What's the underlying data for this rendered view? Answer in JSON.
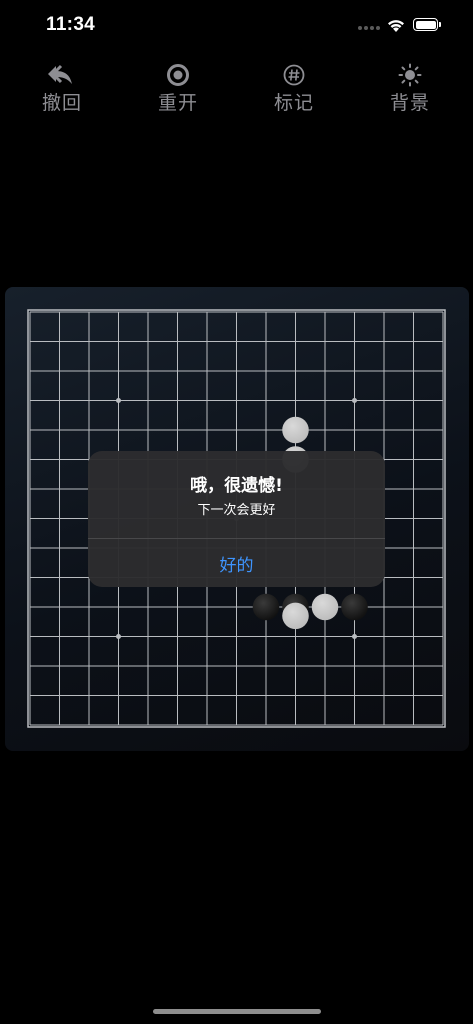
{
  "status_bar": {
    "time": "11:34"
  },
  "toolbar": {
    "items": [
      {
        "label": "撤回",
        "icon": "undo-icon"
      },
      {
        "label": "重开",
        "icon": "restart-icon"
      },
      {
        "label": "标记",
        "icon": "number-sign-icon"
      },
      {
        "label": "背景",
        "icon": "sun-icon"
      }
    ]
  },
  "board": {
    "grid_lines": 15,
    "star_points": [
      [
        3,
        3
      ],
      [
        11,
        3
      ],
      [
        3,
        11
      ],
      [
        11,
        11
      ],
      [
        7,
        7
      ]
    ],
    "stones": [
      {
        "col": 9,
        "row": 4,
        "color": "white"
      },
      {
        "col": 9,
        "row": 5,
        "color": "white"
      },
      {
        "col": 8,
        "row": 10,
        "color": "black"
      },
      {
        "col": 9,
        "row": 10,
        "color": "black"
      },
      {
        "col": 10,
        "row": 10,
        "color": "white"
      },
      {
        "col": 11,
        "row": 10,
        "color": "black"
      },
      {
        "col": 9,
        "row": 10.3,
        "color": "white"
      }
    ],
    "colors": {
      "grid": "#b9bcc0",
      "white_stone": "#bdbdbd",
      "black_stone": "#111111"
    }
  },
  "alert": {
    "title": "哦，很遗憾!",
    "message": "下一次会更好",
    "button_label": "好的",
    "button_color": "#3e95ff"
  }
}
